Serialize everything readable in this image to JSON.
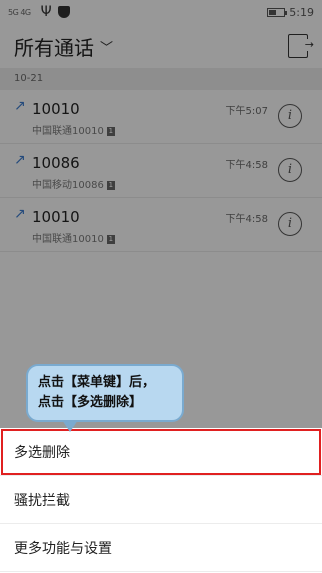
{
  "status_bar": {
    "signal_text": "5G 4G",
    "usb_icon": "usb-icon",
    "shield_icon": "shield-icon",
    "battery_level": 0.5,
    "time": "5:19"
  },
  "header": {
    "title": "所有通话",
    "dropdown_icon": "chevron-down-icon",
    "export_icon": "export-icon"
  },
  "date_label": "10-21",
  "calls": [
    {
      "number": "10010",
      "location": "中国联通10010",
      "sim": "1",
      "time": "下午5:07"
    },
    {
      "number": "10086",
      "location": "中国移动10086",
      "sim": "1",
      "time": "下午4:58"
    },
    {
      "number": "10010",
      "location": "中国联通10010",
      "sim": "1",
      "time": "下午4:58"
    }
  ],
  "menu": {
    "items": [
      "多选删除",
      "骚扰拦截",
      "更多功能与设置"
    ]
  },
  "tooltip": {
    "line1": "点击【菜单键】后，",
    "line2": "点击【多选删除】"
  }
}
